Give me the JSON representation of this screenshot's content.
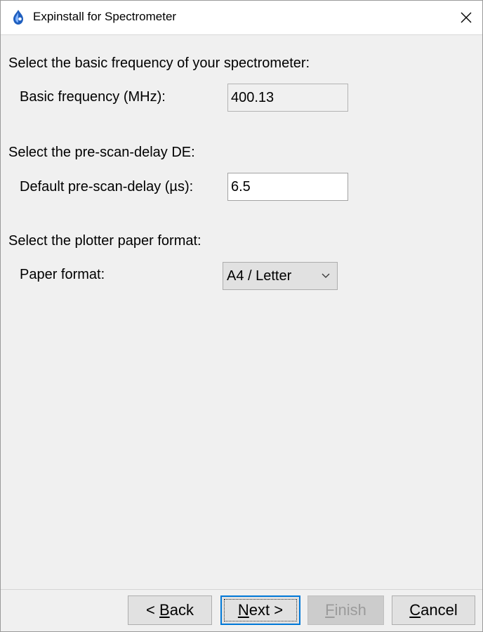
{
  "window": {
    "title": "Expinstall for Spectrometer"
  },
  "sections": {
    "frequency": {
      "heading": "Select the basic frequency of your spectrometer:",
      "field_label": "Basic frequency (MHz):",
      "value": "400.13"
    },
    "delay": {
      "heading": "Select the pre-scan-delay DE:",
      "field_label": "Default pre-scan-delay (µs):",
      "value": "6.5"
    },
    "paper": {
      "heading": "Select the plotter paper format:",
      "field_label": "Paper format:",
      "selected": "A4 / Letter"
    }
  },
  "buttons": {
    "back": {
      "pre": "< ",
      "mnemonic": "B",
      "post": "ack"
    },
    "next": {
      "pre": "",
      "mnemonic": "N",
      "post": "ext >"
    },
    "finish": {
      "pre": "",
      "mnemonic": "F",
      "post": "inish"
    },
    "cancel": {
      "pre": "",
      "mnemonic": "C",
      "post": "ancel"
    }
  },
  "icons": {
    "app": "bruker-app-icon",
    "close": "close-icon",
    "dropdown": "chevron-down-icon"
  },
  "colors": {
    "accent": "#0078d7",
    "window_bg": "#f0f0f0",
    "button_bg": "#e1e1e1",
    "disabled_text": "#9b9b9b"
  }
}
